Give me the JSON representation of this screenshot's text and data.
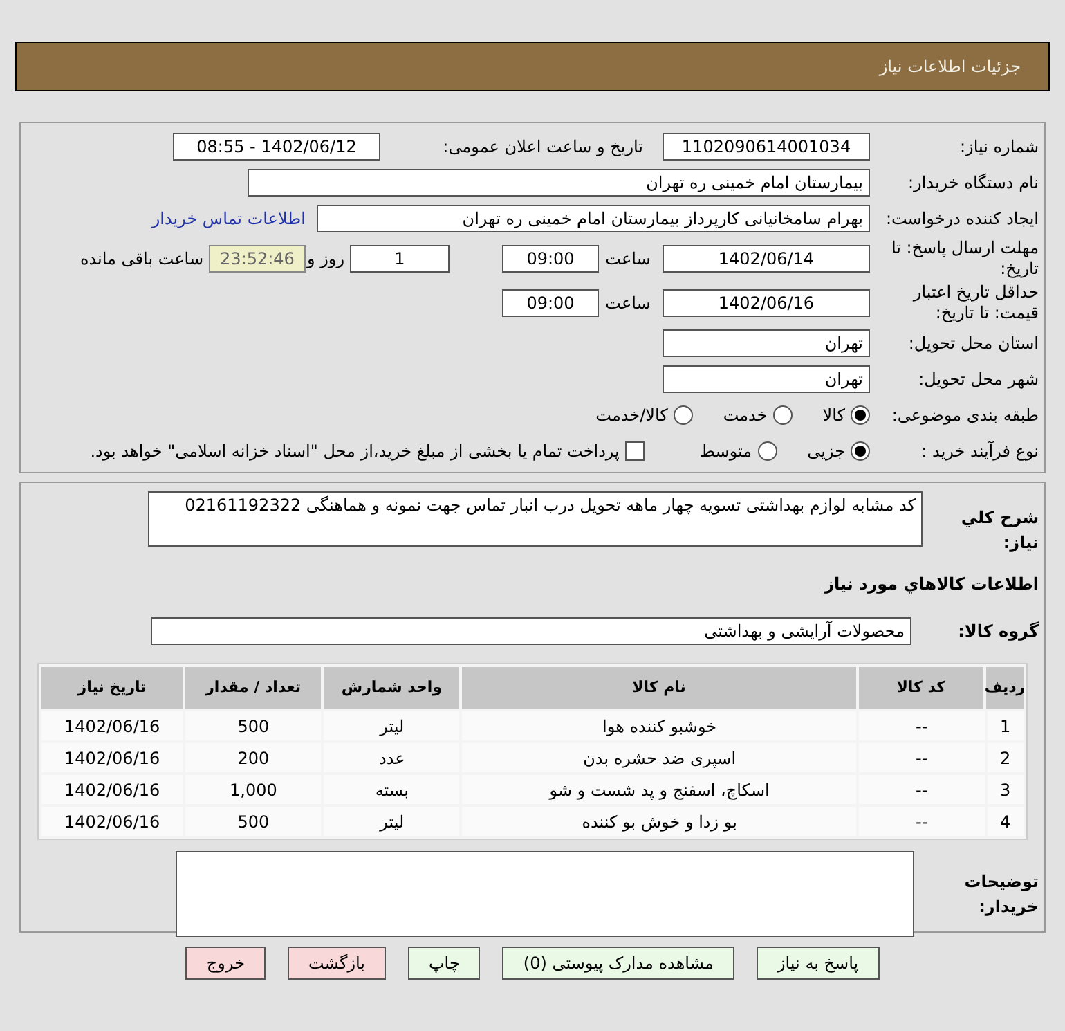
{
  "header": {
    "title": "جزئیات اطلاعات نیاز"
  },
  "need_number": {
    "label": "شماره نیاز:",
    "value": "1102090614001034"
  },
  "announce": {
    "label": "تاریخ و ساعت اعلان عمومی:",
    "value": "1402/06/12 - 08:55"
  },
  "buyer_org": {
    "label": "نام دستگاه خریدار:",
    "value": "بیمارستان امام خمینی ره  تهران"
  },
  "requester": {
    "label": "ایجاد کننده درخواست:",
    "value": "بهرام  سامخانیانی  کارپرداز بیمارستان امام خمینی ره  تهران",
    "link": "اطلاعات تماس خریدار"
  },
  "reply_deadline": {
    "label": "مهلت ارسال پاسخ: تا تاریخ:",
    "date": "1402/06/14",
    "time_label": "ساعت",
    "time": "09:00",
    "days": "1",
    "days_label": "روز و",
    "remaining": "23:52:46",
    "remaining_label": "ساعت باقی مانده"
  },
  "validity": {
    "label": "حداقل تاریخ اعتبار قیمت: تا تاریخ:",
    "date": "1402/06/16",
    "time_label": "ساعت",
    "time": "09:00"
  },
  "province": {
    "label": "استان محل تحویل:",
    "value": "تهران"
  },
  "city": {
    "label": "شهر محل تحویل:",
    "value": "تهران"
  },
  "category": {
    "label": "طبقه بندی موضوعی:",
    "options": [
      {
        "label": "کالا",
        "selected": true
      },
      {
        "label": "خدمت",
        "selected": false
      },
      {
        "label": "کالا/خدمت",
        "selected": false
      }
    ]
  },
  "process": {
    "label": "نوع فرآیند خرید :",
    "options": [
      {
        "label": "جزیی",
        "selected": true
      },
      {
        "label": "متوسط",
        "selected": false
      }
    ],
    "treasury": {
      "label": "پرداخت تمام یا بخشی از مبلغ خرید،از محل \"اسناد خزانه اسلامی\" خواهد بود.",
      "checked": false
    }
  },
  "description": {
    "label": "شرح کلي نياز:",
    "value": "کد مشابه لوازم بهداشتی  تسویه چهار ماهه تحویل درب انبار تماس جهت نمونه و هماهنگی 02161192322"
  },
  "items_title": "اطلاعات کالاهاي مورد نياز",
  "group": {
    "label": "گروه کالا:",
    "value": "محصولات آرایشی و بهداشتی"
  },
  "table": {
    "columns": [
      "ردیف",
      "کد کالا",
      "نام کالا",
      "واحد شمارش",
      "تعداد / مقدار",
      "تاریخ نیاز"
    ],
    "rows": [
      [
        "1",
        "--",
        "خوشبو کننده هوا",
        "لیتر",
        "500",
        "1402/06/16"
      ],
      [
        "2",
        "--",
        "اسپری ضد حشره بدن",
        "عدد",
        "200",
        "1402/06/16"
      ],
      [
        "3",
        "--",
        "اسکاچ، اسفنج و پد شست و شو",
        "بسته",
        "1,000",
        "1402/06/16"
      ],
      [
        "4",
        "--",
        "بو زدا و خوش بو کننده",
        "لیتر",
        "500",
        "1402/06/16"
      ]
    ]
  },
  "notes": {
    "label": "توضیحات خریدار:"
  },
  "buttons": [
    {
      "label": "پاسخ به نیاز",
      "kind": "primary"
    },
    {
      "label": "مشاهده مدارک پیوستی (0)",
      "kind": "primary"
    },
    {
      "label": "چاپ",
      "kind": "primary"
    },
    {
      "label": "بازگشت",
      "kind": "danger"
    },
    {
      "label": "خروج",
      "kind": "danger"
    }
  ]
}
